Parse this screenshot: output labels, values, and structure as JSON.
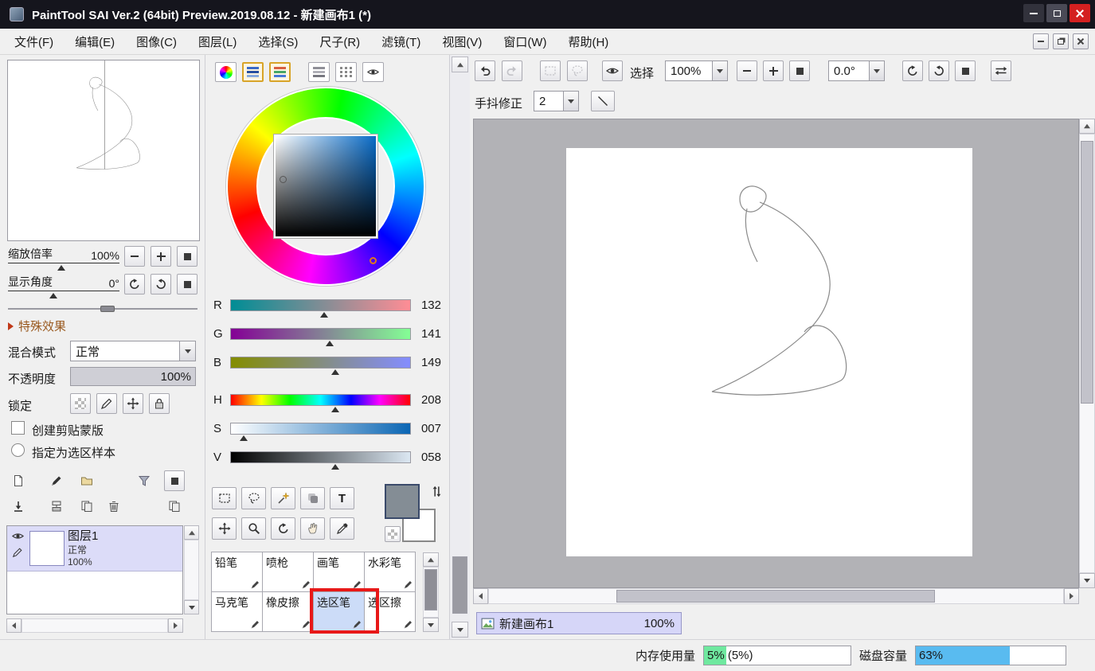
{
  "window": {
    "title": "PaintTool SAI Ver.2 (64bit) Preview.2019.08.12 - 新建画布1 (*)"
  },
  "menu": {
    "items": [
      "文件(F)",
      "编辑(E)",
      "图像(C)",
      "图层(L)",
      "选择(S)",
      "尺子(R)",
      "滤镜(T)",
      "视图(V)",
      "窗口(W)",
      "帮助(H)"
    ]
  },
  "navigator": {
    "zoom_label": "缩放倍率",
    "zoom_value": "100%",
    "angle_label": "显示角度",
    "angle_value": "0°"
  },
  "special_effects": {
    "label": "特殊效果"
  },
  "layer_panel": {
    "blend_mode_label": "混合模式",
    "blend_mode_value": "正常",
    "opacity_label": "不透明度",
    "opacity_value": "100%",
    "opacity_pct": 100,
    "lock_label": "锁定",
    "clipping_label": "创建剪贴蒙版",
    "selection_source_label": "指定为选区样本",
    "layers": [
      {
        "name": "图层1",
        "mode": "正常",
        "opacity": "100%"
      }
    ]
  },
  "color_panel": {
    "current_color": "#848d95",
    "secondary_color": "#ffffff",
    "sliders": [
      {
        "label": "R",
        "value": "132",
        "pct": 52
      },
      {
        "label": "G",
        "value": "141",
        "pct": 55
      },
      {
        "label": "B",
        "value": "149",
        "pct": 58
      },
      {
        "label": "H",
        "value": "208",
        "pct": 58
      },
      {
        "label": "S",
        "value": "007",
        "pct": 7
      },
      {
        "label": "V",
        "value": "058",
        "pct": 58
      }
    ]
  },
  "tool_panel": {
    "text_tool_label": "T",
    "brushes": [
      "铅笔",
      "喷枪",
      "画笔",
      "水彩笔",
      "马克笔",
      "橡皮擦",
      "选区笔",
      "选区擦"
    ],
    "selected_brush": "选区笔",
    "highlight_color": "#e81818"
  },
  "canvas_toolbar": {
    "selection_label": "选择",
    "zoom_value": "100%",
    "angle_value": "0.0°",
    "stabilizer_label": "手抖修正",
    "stabilizer_value": "2"
  },
  "canvas_tab": {
    "name": "新建画布1",
    "zoom": "100%"
  },
  "status_bar": {
    "memory_label": "内存使用量",
    "memory_text": "5% (5%)",
    "memory_pct": 15,
    "memory_fill_color": "#6fe89f",
    "disk_label": "磁盘容量",
    "disk_text": "63%",
    "disk_pct": 63,
    "disk_fill_color": "#59bbf0"
  }
}
